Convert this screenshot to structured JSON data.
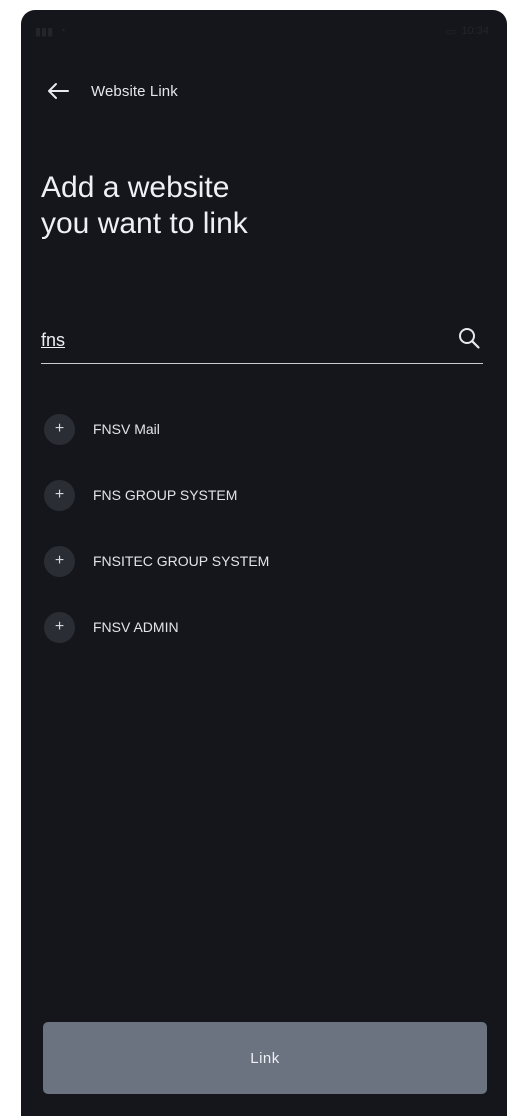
{
  "status_bar": {
    "left": "|||  ",
    "right": "10:34"
  },
  "header": {
    "title": "Website Link"
  },
  "page": {
    "title_line1": "Add a website",
    "title_line2": "you want to link"
  },
  "search": {
    "value": "fns",
    "placeholder": ""
  },
  "results": [
    {
      "label": "FNSV Mail"
    },
    {
      "label": "FNS GROUP SYSTEM"
    },
    {
      "label": "FNSITEC GROUP SYSTEM"
    },
    {
      "label": "FNSV ADMIN"
    }
  ],
  "actions": {
    "link_label": "Link"
  },
  "colors": {
    "background": "#14161b",
    "button": "#6b7280",
    "plus_circle": "#2a2d34",
    "text": "#e4e6ea"
  },
  "icons": {
    "back": "arrow-left-icon",
    "search": "search-icon",
    "add": "plus-icon"
  }
}
